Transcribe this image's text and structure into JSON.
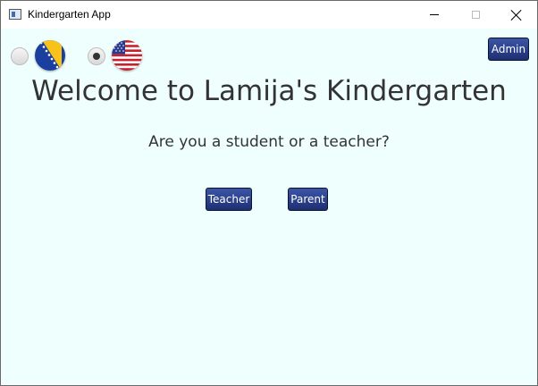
{
  "window": {
    "title": "Kindergarten App",
    "controls": [
      "minimize",
      "maximize",
      "close"
    ]
  },
  "language": {
    "options": [
      {
        "flag": "bosnia-flag",
        "selected": false
      },
      {
        "flag": "usa-flag",
        "selected": true
      }
    ]
  },
  "header": {
    "admin_label": "Admin"
  },
  "main": {
    "welcome": "Welcome to Lamija's Kindergarten",
    "question": "Are you a student or a teacher?",
    "teacher_label": "Teacher",
    "parent_label": "Parent"
  },
  "colors": {
    "background": "#eefffe",
    "button": "#2a3f8f",
    "text": "#333333"
  }
}
